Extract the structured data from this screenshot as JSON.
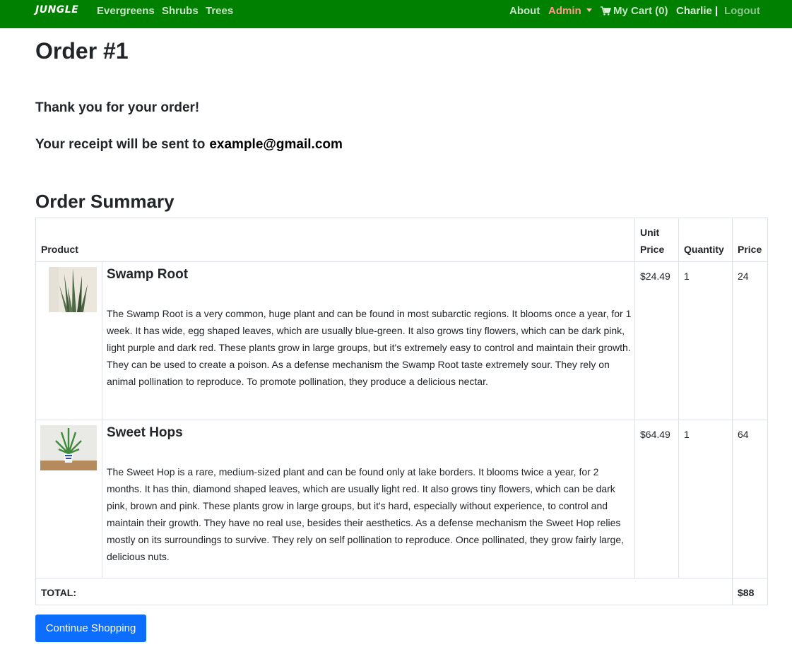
{
  "nav": {
    "brand": "JUNGLE",
    "links": [
      "Evergreens",
      "Shrubs",
      "Trees"
    ],
    "about": "About",
    "admin": "Admin",
    "cart": "My Cart (0)",
    "user": "Charlie",
    "separator": "|",
    "logout": "Logout"
  },
  "order": {
    "title": "Order #1",
    "thanks": "Thank you for your order!",
    "receipt_prefix": "Your receipt will be sent to",
    "email": "example@gmail.com"
  },
  "summary": {
    "title": "Order Summary",
    "headers": {
      "product": "Product",
      "unit_price_line1": "Unit",
      "unit_price_line2": "Price",
      "quantity": "Quantity",
      "price": "Price"
    },
    "items": [
      {
        "name": "Swamp Root",
        "description": "The Swamp Root is a very common, huge plant and can be found in most subarctic regions. It blooms once a year, for 1 week. It has wide, egg shaped leaves, which are usually blue-green. It also grows tiny flowers, which can be dark pink, light purple and dark red. These plants grow in large groups, but it's extremely easy to control and maintain their growth. They can be used to create a poison. As a defense mechanism the Swamp Root taste extremely sour. They rely on animal pollination to reproduce. To promote pollination, they produce a delicious nectar.",
        "unit_price": "$24.49",
        "quantity": "1",
        "price": "24"
      },
      {
        "name": "Sweet Hops",
        "description": "The Sweet Hop is a rare, medium-sized plant and can be found only at lake borders. It blooms twice a year, for 2 months. It has thin, diamond shaped leaves, which are usually light red. It also grows tiny flowers, which can be dark pink, brown and pink. These plants grow in large groups, but it's hard, especially without experience, to control and maintain their growth. They have no real use, besides their aesthetics. As a defense mechanism the Sweet Hop relies mostly on its surroundings to survive. They rely on self pollination to reproduce. Once pollinated, they grow fairly large, delicious nuts.",
        "unit_price": "$64.49",
        "quantity": "1",
        "price": "64"
      }
    ],
    "total_label": "TOTAL:",
    "total_value": "$88"
  },
  "actions": {
    "continue": "Continue Shopping"
  },
  "colors": {
    "navbar": "#008000",
    "admin": "#ff9a8a",
    "button": "#0d6efd"
  }
}
